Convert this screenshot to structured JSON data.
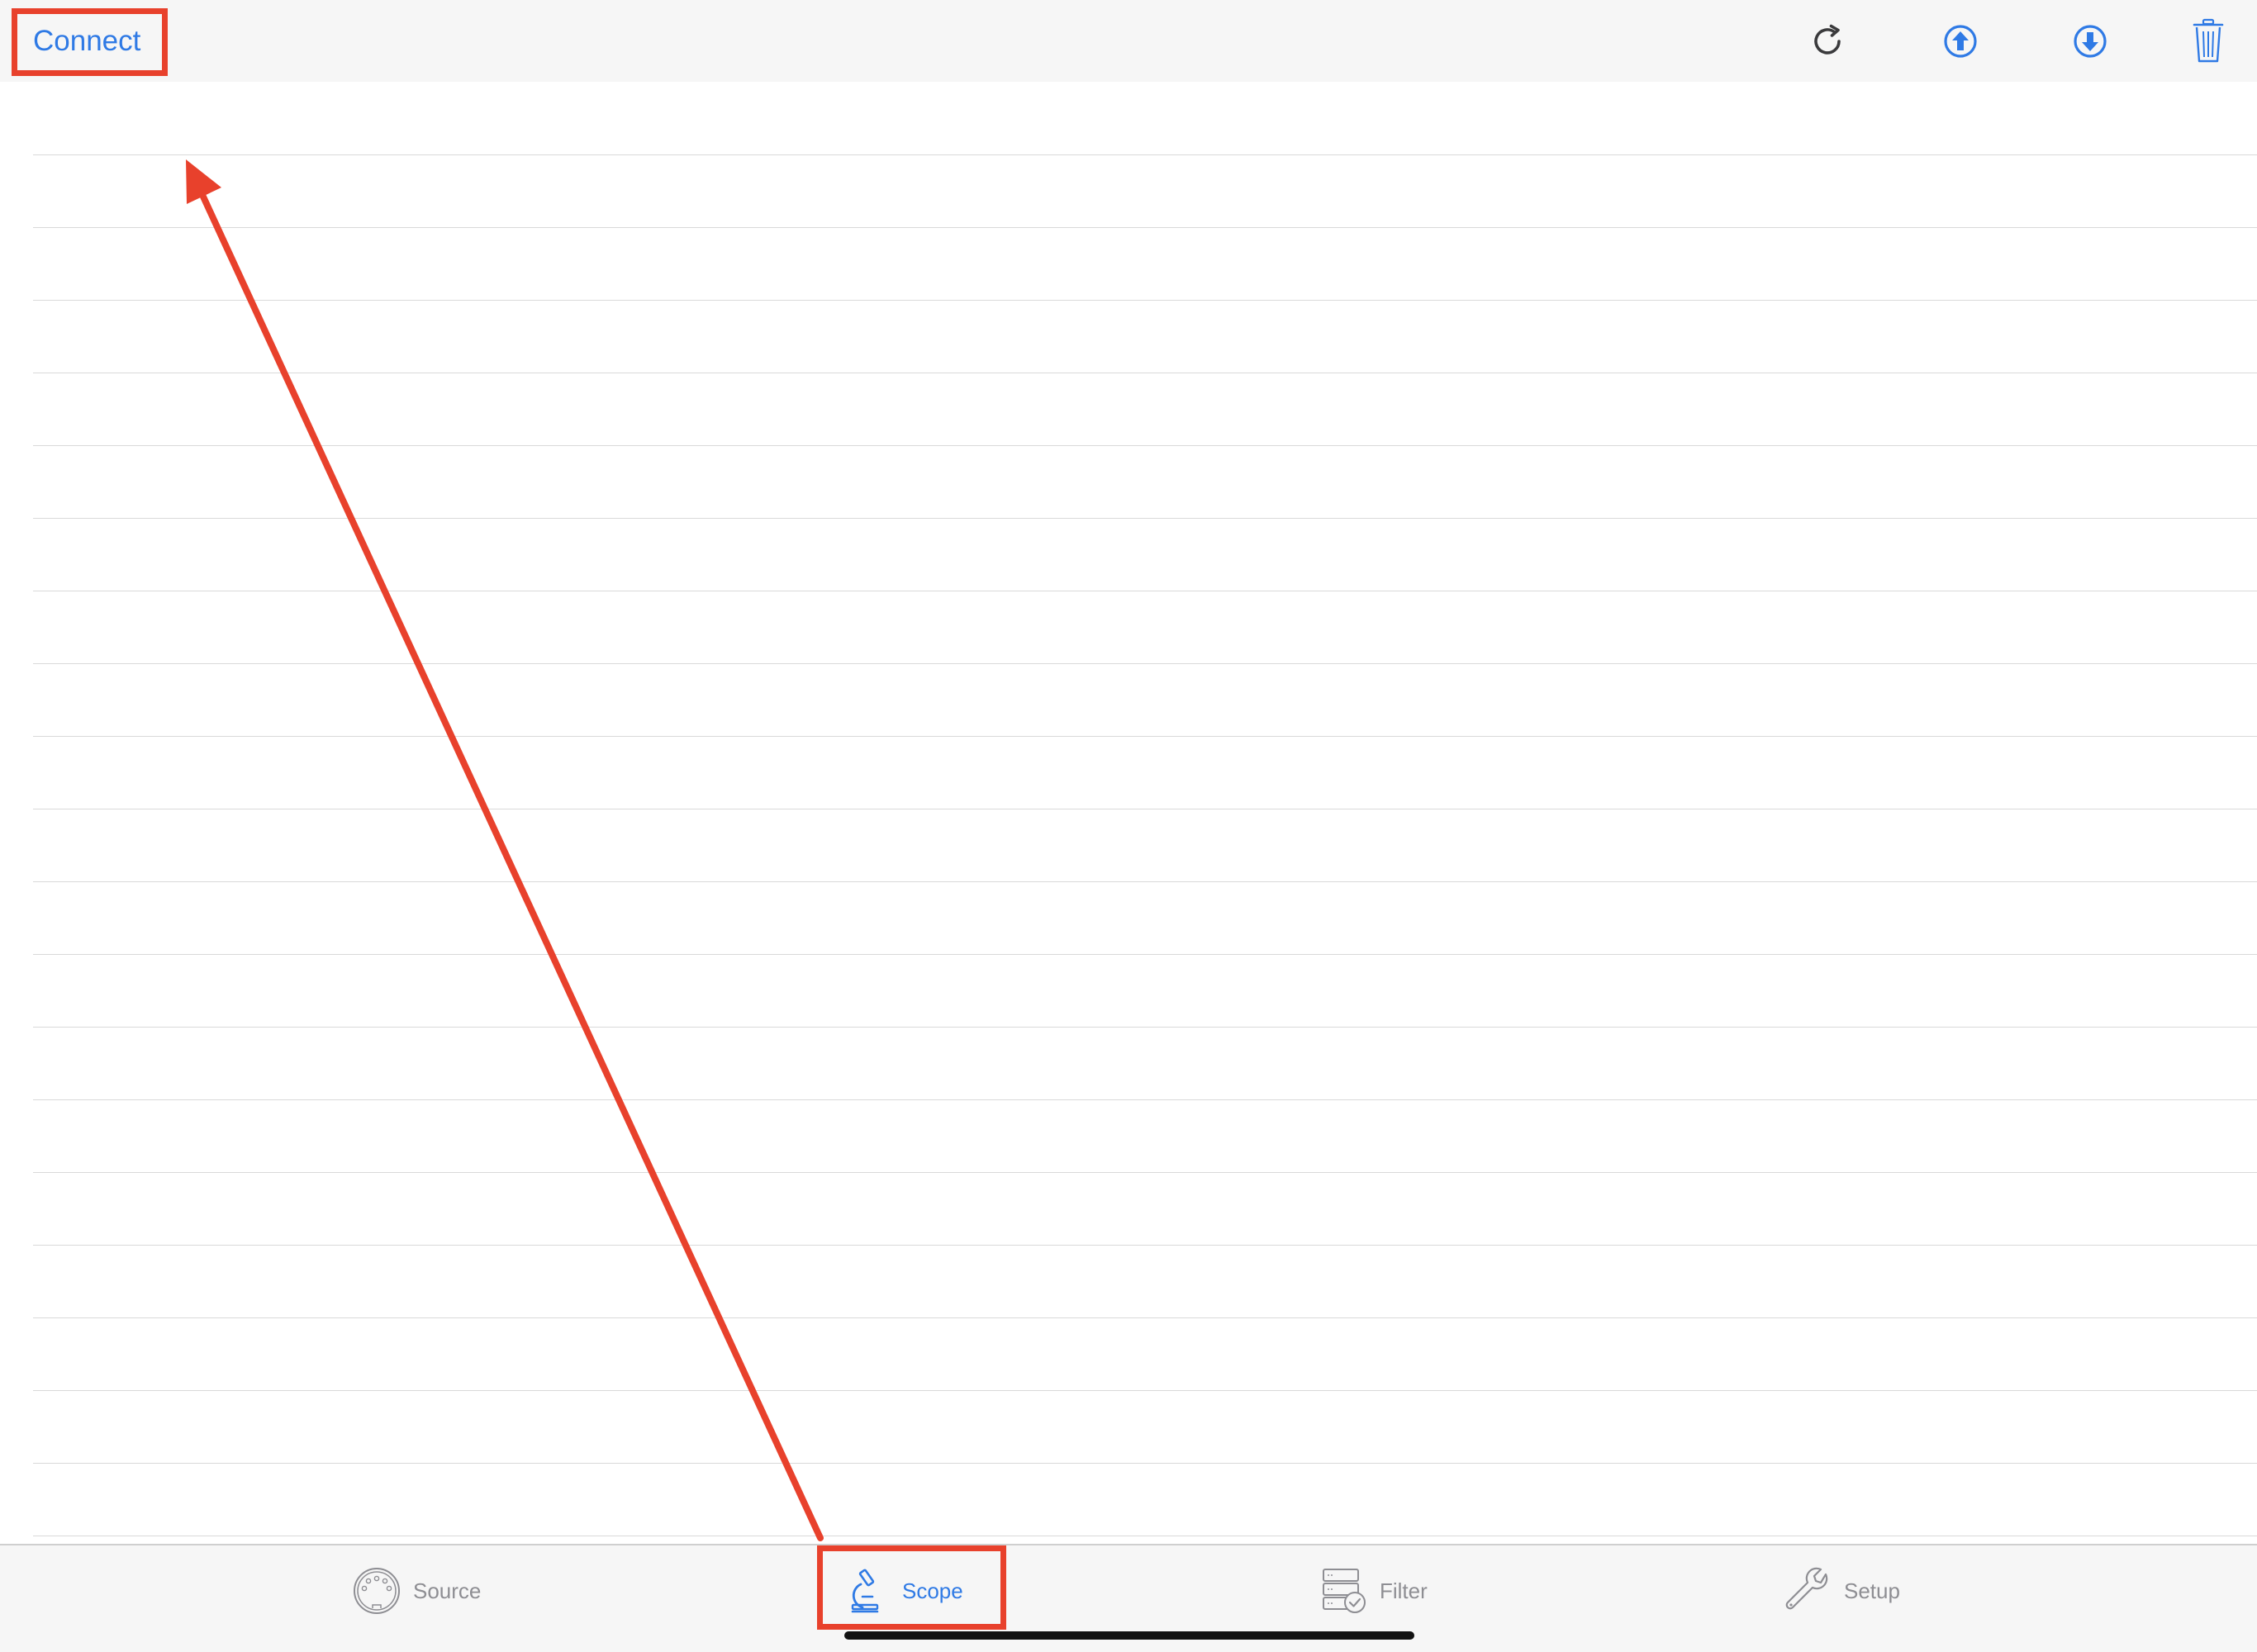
{
  "colors": {
    "accent": "#2f7ae5",
    "inactive": "#8e8e93",
    "annotation": "#e8412c",
    "icon_dark": "#3a3a3c"
  },
  "navbar": {
    "connect_label": "Connect",
    "icons": [
      "refresh-icon",
      "upload-icon",
      "download-icon",
      "trash-icon"
    ]
  },
  "tabbar": {
    "tabs": [
      {
        "label": "Source",
        "icon": "midi-port-icon",
        "active": false
      },
      {
        "label": "Scope",
        "icon": "microscope-icon",
        "active": true
      },
      {
        "label": "Filter",
        "icon": "filter-list-icon",
        "active": false
      },
      {
        "label": "Setup",
        "icon": "wrench-icon",
        "active": false
      }
    ]
  }
}
